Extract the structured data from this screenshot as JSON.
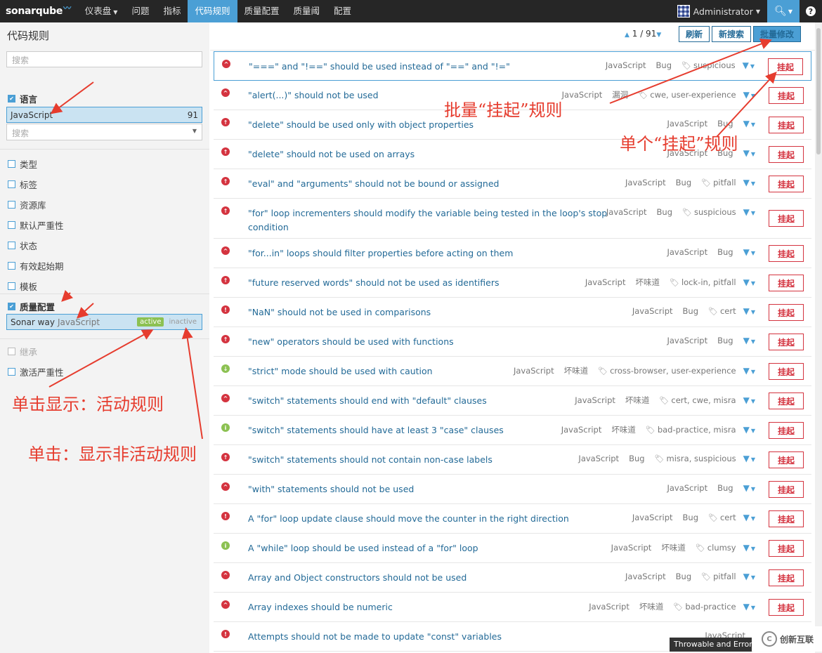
{
  "nav": {
    "logo": "sonarqube",
    "items": [
      {
        "label": "仪表盘",
        "dropdown": true,
        "active": false
      },
      {
        "label": "问题",
        "active": false
      },
      {
        "label": "指标",
        "active": false
      },
      {
        "label": "代码规则",
        "active": true
      },
      {
        "label": "质量配置",
        "active": false
      },
      {
        "label": "质量阈",
        "active": false
      },
      {
        "label": "配置",
        "active": false
      }
    ],
    "user": "Administrator"
  },
  "sidebar": {
    "title": "代码规则",
    "search_placeholder": "搜索",
    "language": {
      "label": "语言",
      "value": "JavaScript",
      "count": "91",
      "search_placeholder": "搜索"
    },
    "facets": [
      "类型",
      "标签",
      "资源库",
      "默认严重性",
      "状态",
      "有效起始期",
      "模板"
    ],
    "quality_profile": {
      "label": "质量配置",
      "name": "Sonar way",
      "lang": "JavaScript",
      "active": "active",
      "inactive": "inactive"
    },
    "inheritance": "继承",
    "active_severity": "激活严重性"
  },
  "toolbar": {
    "pager": "1 / 91",
    "refresh": "刷新",
    "new_search": "新搜索",
    "bulk_change": "批量修改"
  },
  "deactivate_label": "挂起",
  "rules": [
    {
      "title": "\"===\" and \"!==\" should be used instead of \"==\" and \"!=\"",
      "lang": "JavaScript",
      "type": "Bug",
      "tags": "suspicious",
      "sev": "major"
    },
    {
      "title": "\"alert(...)\" should not be used",
      "lang": "JavaScript",
      "type": "漏洞",
      "tags": "cwe, user-experience",
      "sev": "major"
    },
    {
      "title": "\"delete\" should be used only with object properties",
      "lang": "JavaScript",
      "type": "Bug",
      "tags": "",
      "sev": "critical"
    },
    {
      "title": "\"delete\" should not be used on arrays",
      "lang": "JavaScript",
      "type": "Bug",
      "tags": "",
      "sev": "critical"
    },
    {
      "title": "\"eval\" and \"arguments\" should not be bound or assigned",
      "lang": "JavaScript",
      "type": "Bug",
      "tags": "pitfall",
      "sev": "critical"
    },
    {
      "title": "\"for\" loop incrementers should modify the variable being tested in the loop's stop",
      "title2": "condition",
      "lang": "JavaScript",
      "type": "Bug",
      "tags": "suspicious",
      "sev": "critical"
    },
    {
      "title": "\"for...in\" loops should filter properties before acting on them",
      "lang": "JavaScript",
      "type": "Bug",
      "tags": "",
      "sev": "major"
    },
    {
      "title": "\"future reserved words\" should not be used as identifiers",
      "lang": "JavaScript",
      "type": "坏味道",
      "tags": "lock-in, pitfall",
      "sev": "critical"
    },
    {
      "title": "\"NaN\" should not be used in comparisons",
      "lang": "JavaScript",
      "type": "Bug",
      "tags": "cert",
      "sev": "blocker"
    },
    {
      "title": "\"new\" operators should be used with functions",
      "lang": "JavaScript",
      "type": "Bug",
      "tags": "",
      "sev": "critical"
    },
    {
      "title": "\"strict\" mode should be used with caution",
      "lang": "JavaScript",
      "type": "坏味道",
      "tags": "cross-browser, user-experience",
      "sev": "minor"
    },
    {
      "title": "\"switch\" statements should end with \"default\" clauses",
      "lang": "JavaScript",
      "type": "坏味道",
      "tags": "cert, cwe, misra",
      "sev": "major"
    },
    {
      "title": "\"switch\" statements should have at least 3 \"case\" clauses",
      "lang": "JavaScript",
      "type": "坏味道",
      "tags": "bad-practice, misra",
      "sev": "info"
    },
    {
      "title": "\"switch\" statements should not contain non-case labels",
      "lang": "JavaScript",
      "type": "Bug",
      "tags": "misra, suspicious",
      "sev": "critical"
    },
    {
      "title": "\"with\" statements should not be used",
      "lang": "JavaScript",
      "type": "Bug",
      "tags": "",
      "sev": "major"
    },
    {
      "title": "A \"for\" loop update clause should move the counter in the right direction",
      "lang": "JavaScript",
      "type": "Bug",
      "tags": "cert",
      "sev": "blocker"
    },
    {
      "title": "A \"while\" loop should be used instead of a \"for\" loop",
      "lang": "JavaScript",
      "type": "坏味道",
      "tags": "clumsy",
      "sev": "info"
    },
    {
      "title": "Array and Object constructors should not be used",
      "lang": "JavaScript",
      "type": "Bug",
      "tags": "pitfall",
      "sev": "major"
    },
    {
      "title": "Array indexes should be numeric",
      "lang": "JavaScript",
      "type": "坏味道",
      "tags": "bad-practice",
      "sev": "major"
    },
    {
      "title": "Attempts should not be made to update \"const\" variables",
      "lang": "JavaScript",
      "type": "",
      "tags": "",
      "sev": "blocker"
    }
  ],
  "annotations": {
    "bulk": "批量“挂起”规则",
    "single": "单个“挂起”规则",
    "click_active": "单击显示：活动规则",
    "click_inactive": "单击：显示非活动规则"
  },
  "tooltip": "Throwable and Error",
  "watermark": "创新互联"
}
